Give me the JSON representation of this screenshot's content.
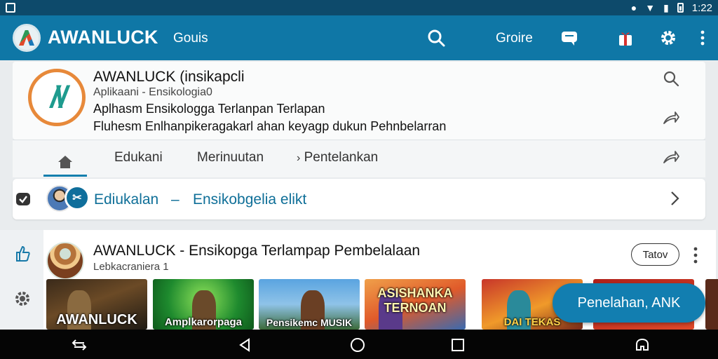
{
  "status": {
    "time": "1:22"
  },
  "appbar": {
    "title": "AWANLUCK",
    "subtitle": "Gouis",
    "genre_label": "Groire",
    "icons": [
      "search-icon",
      "cast-icon",
      "gift-icon",
      "gear-icon",
      "more-vert-icon"
    ]
  },
  "profile": {
    "title": "AWANLUCK (insikapcli",
    "subtitle": "Aplikaani - Ensikologia0",
    "line1": "Aplhasm Ensikologga Terlanpan Terlapan",
    "line2": "Fluhesm Enlhanpikeragakarl ahan keyagp dukun Pehnbelarran"
  },
  "tabs": [
    {
      "label": "Edukani"
    },
    {
      "label": "Merinuutan"
    },
    {
      "label": "Pentelankan"
    }
  ],
  "edu_row": {
    "title": "Ediukalan",
    "dash": "–",
    "subtitle": "Ensikobgelia elikt"
  },
  "post": {
    "title": "AWANLUCK - Ensikopga Terlampap Pembelalaan",
    "subtitle": "Lebkacraniera 1",
    "follow_label": "Tatov",
    "thumbnails": [
      {
        "caption": "AWANLUCK"
      },
      {
        "caption": "Amplkarorpaga"
      },
      {
        "caption": "Pensikemc MUSIK"
      },
      {
        "caption": "ASISHANKA TERNOAN"
      },
      {
        "caption": "DAI TEKAS"
      },
      {
        "caption": ""
      }
    ]
  },
  "fab": {
    "label": "Penelahan, ANK"
  },
  "colors": {
    "appbar": "#0f77a6",
    "statusbar": "#0d4a6b",
    "accent_text": "#0f6f98",
    "fab": "#127eb0"
  }
}
